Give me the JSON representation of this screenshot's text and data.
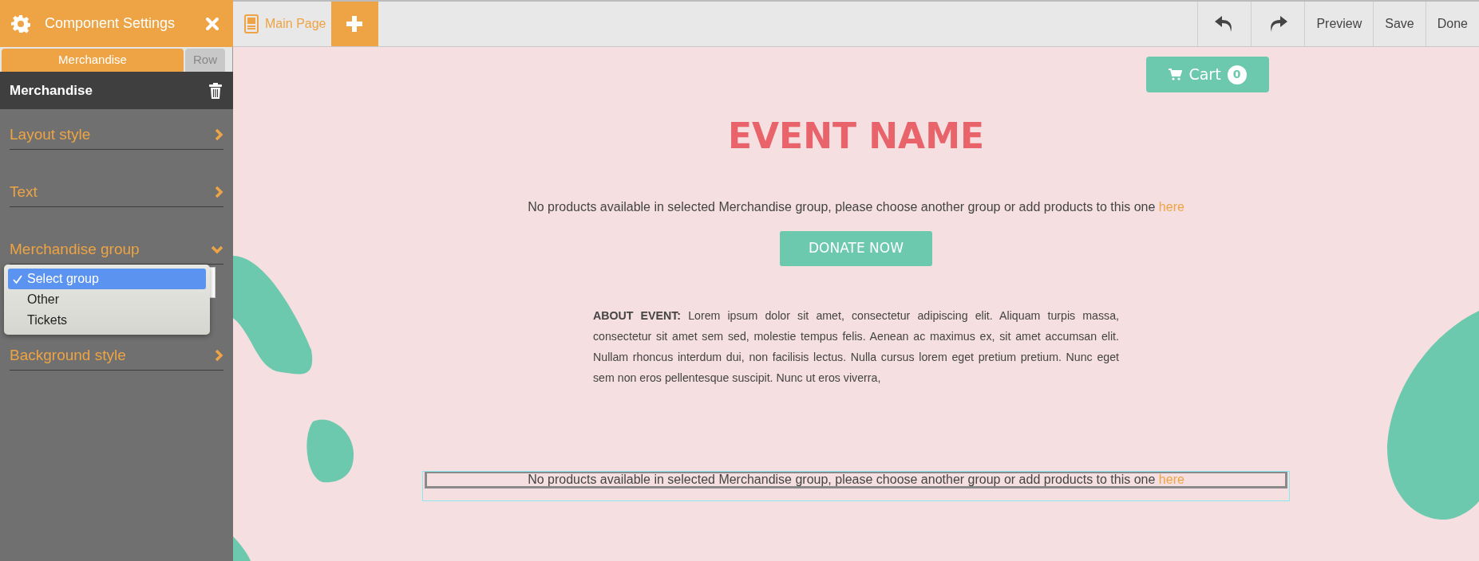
{
  "sidebar": {
    "title": "Component Settings",
    "tabs": [
      {
        "label": "Merchandise",
        "selected": true
      },
      {
        "label": "Row",
        "selected": false
      }
    ],
    "section_title": "Merchandise",
    "items": [
      {
        "label": "Layout style",
        "expanded": false
      },
      {
        "label": "Text",
        "expanded": false
      },
      {
        "label": "Merchandise group",
        "expanded": true
      },
      {
        "label": "Background style",
        "expanded": false
      }
    ],
    "dropdown": {
      "options": [
        {
          "label": "Select group",
          "selected": true
        },
        {
          "label": "Other",
          "selected": false
        },
        {
          "label": "Tickets",
          "selected": false
        }
      ]
    }
  },
  "toolbar": {
    "page_tab": "Main Page",
    "actions": [
      "Preview",
      "Save",
      "Done"
    ]
  },
  "canvas": {
    "cart": {
      "label": "Cart",
      "count": "0"
    },
    "title": "EVENT NAME",
    "messages": [
      {
        "text": "No products available in selected Merchandise group, please choose another group or add products to this one ",
        "link": "here",
        "selected": false
      },
      {
        "text": "No products available in selected Merchandise group, please choose another group or add products to this one ",
        "link": "here",
        "selected": true
      }
    ],
    "donate": "DONATE NOW",
    "about": "**ABOUT EVENT:** Lorem ipsum dolor sit amet, consectetur adipiscing elit. Aliquam turpis massa, consectetur sit amet sem sed, molestie tempus felis. Aenean ac maximus ex, sit amet accumsan elit. Nullam rhoncus interdum dui, non facilisis lectus. Nulla cursus lorem eget pretium pretium. Nunc eget sem non eros pellentesque suscipit. Nunc ut eros viverra,"
  }
}
